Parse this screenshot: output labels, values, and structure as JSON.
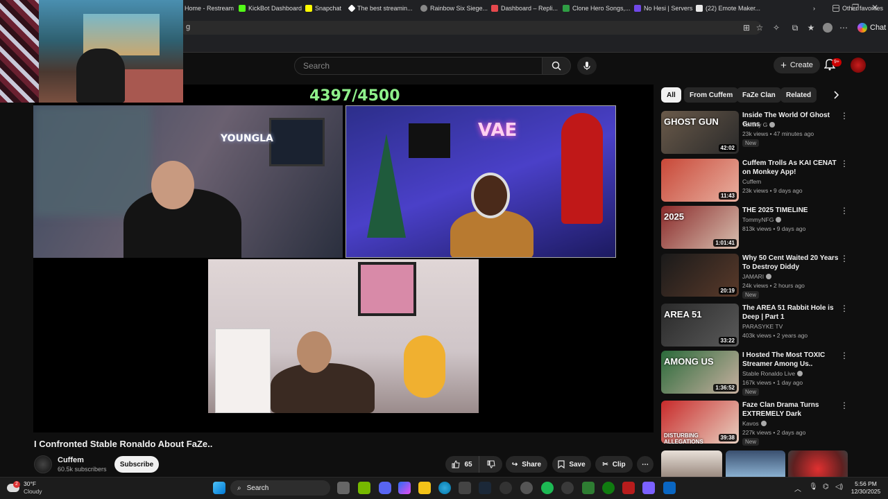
{
  "browser": {
    "address": "g",
    "chat_label": "Chat",
    "bookmarks": [
      {
        "label": "Home - Restream",
        "color": "#444"
      },
      {
        "label": "KickBot Dashboard",
        "color": "#53fc18"
      },
      {
        "label": "Snapchat",
        "color": "#fffc00"
      },
      {
        "label": "The best streamin...",
        "color": "#ffffff"
      },
      {
        "label": "Rainbow Six Siege...",
        "color": "#888"
      },
      {
        "label": "Dashboard – Repli...",
        "color": "#e5484d"
      },
      {
        "label": "Clone Hero Songs,...",
        "color": "#2f9e44"
      },
      {
        "label": "No Hesi | Servers",
        "color": "#7048e8"
      },
      {
        "label": "(22) Emote Maker...",
        "color": "#e8e8e8"
      },
      {
        "label": "Other favorites",
        "color": "#888"
      }
    ]
  },
  "header": {
    "search_placeholder": "Search",
    "create_label": "Create",
    "notification_badge": "9+"
  },
  "player": {
    "counter": "4397/4500",
    "cam_logos": [
      "YOUNGLA",
      "VAE"
    ]
  },
  "video": {
    "title": "I Confronted Stable Ronaldo About FaZe..",
    "channel": "Cuffem",
    "subscribers": "60.5k subscribers",
    "subscribe_label": "Subscribe",
    "likes": "65",
    "share_label": "Share",
    "save_label": "Save",
    "clip_label": "Clip"
  },
  "chips": [
    "All",
    "From Cuffem",
    "FaZe Clan",
    "Related"
  ],
  "recommendations": [
    {
      "title": "Inside The World Of Ghost Guns",
      "channel": "Tommy G",
      "verified": true,
      "meta": "23k views • 47 minutes ago",
      "badge": "New",
      "duration": "42:02",
      "thumb_text": "GHOST GUN",
      "thumb_colors": [
        "#6a5a4a",
        "#2a2a2a"
      ]
    },
    {
      "title": "Cuffem Trolls As KAI CENAT on Monkey App!",
      "channel": "Cuffem",
      "verified": false,
      "meta": "23k views • 9 days ago",
      "badge": "",
      "duration": "11:43",
      "thumb_text": "",
      "thumb_colors": [
        "#c84838",
        "#e8b0a0"
      ]
    },
    {
      "title": "THE 2025 TIMELINE",
      "channel": "TommyNFG",
      "verified": true,
      "meta": "813k views • 9 days ago",
      "badge": "",
      "duration": "1:01:41",
      "thumb_text": "2025",
      "thumb_colors": [
        "#8a2a2a",
        "#d8c0b0"
      ]
    },
    {
      "title": "Why 50 Cent Waited 20 Years To Destroy Diddy",
      "channel": "JAMARI",
      "verified": true,
      "meta": "24k views • 2 hours ago",
      "badge": "New",
      "duration": "20:19",
      "thumb_text": "",
      "thumb_colors": [
        "#1a1a1a",
        "#5a3a2a"
      ]
    },
    {
      "title": "The AREA 51 Rabbit Hole is Deep | Part 1",
      "channel": "PARASYKE TV",
      "verified": false,
      "meta": "403k views • 2 years ago",
      "badge": "",
      "duration": "33:22",
      "thumb_text": "AREA 51",
      "thumb_colors": [
        "#2a2a2a",
        "#5a5a5a"
      ]
    },
    {
      "title": "I Hosted The Most TOXIC Streamer Among Us..",
      "channel": "Stable Ronaldo Live",
      "verified": true,
      "meta": "167k views • 1 day ago",
      "badge": "New",
      "duration": "1:36:52",
      "thumb_text": "AMONG US",
      "thumb_colors": [
        "#2a6a3a",
        "#c8b0a0"
      ]
    },
    {
      "title": "Faze Clan Drama Turns EXTREMELY Dark",
      "channel": "Kavos",
      "verified": true,
      "meta": "227k views • 2 days ago",
      "badge": "New",
      "duration": "39:38",
      "thumb_text": "DISTURBING ALLEGATIONS",
      "thumb_colors": [
        "#c82a2a",
        "#e8d0c0"
      ]
    }
  ],
  "taskbar": {
    "temperature": "30°F",
    "condition": "Cloudy",
    "search_label": "Search",
    "time": "5:56 PM",
    "date": "12/30/2025",
    "weather_badge": "2"
  }
}
